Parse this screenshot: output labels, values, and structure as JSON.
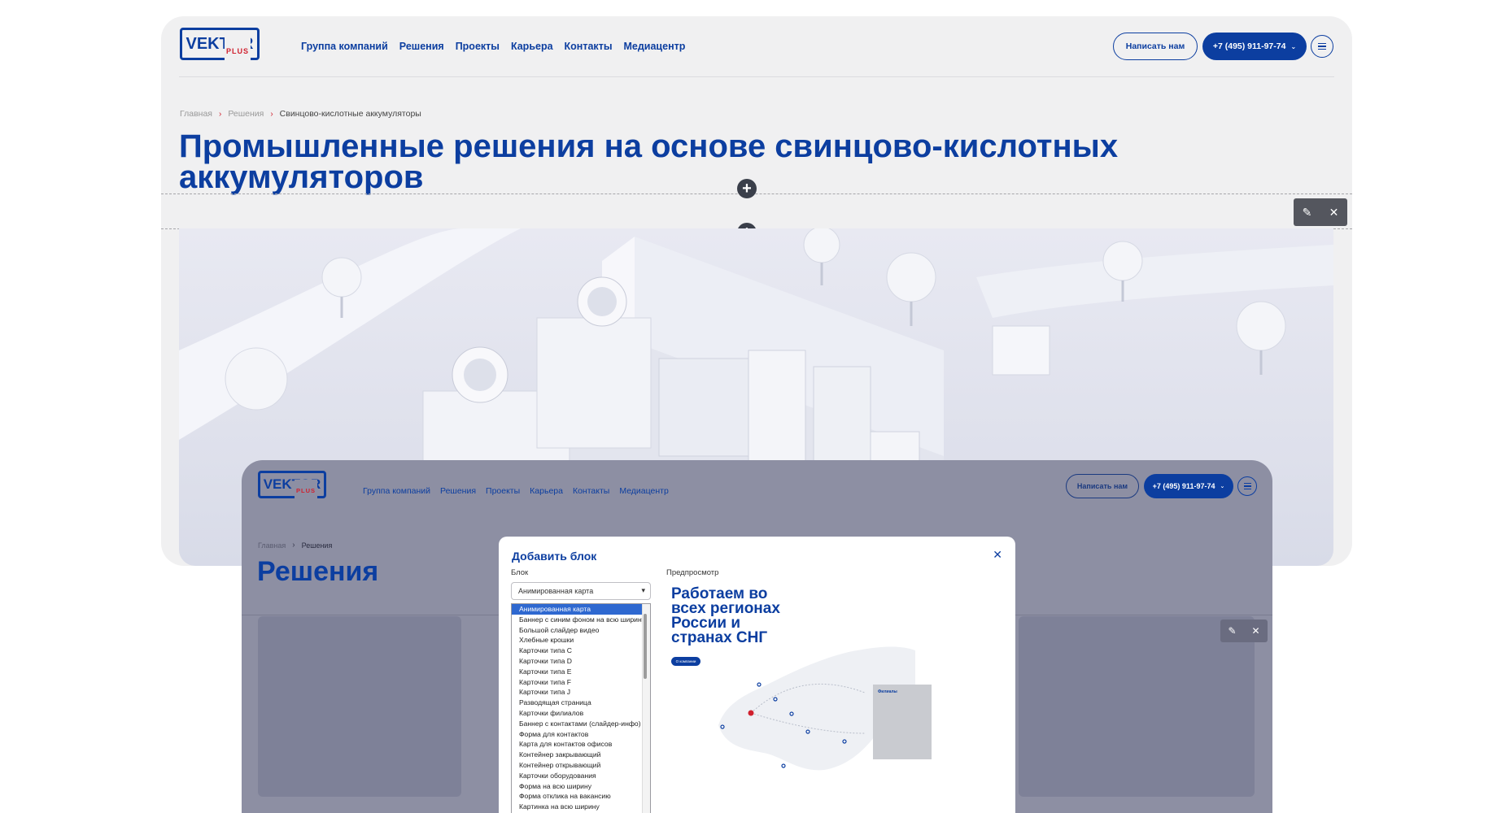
{
  "site": {
    "logo_text": "VEKTOR",
    "logo_sub": "PLUS",
    "nav": [
      "Группа компаний",
      "Решения",
      "Проекты",
      "Карьера",
      "Контакты",
      "Медиацентр"
    ],
    "write_button": "Написать нам",
    "phone_button": "+7 (495) 911-97-74"
  },
  "back_page": {
    "breadcrumbs": [
      "Главная",
      "Решения",
      "Свинцово-кислотные аккумуляторы"
    ],
    "title_line1": "Промышленные решения на основе свинцово-кислотных",
    "title_line2": "аккумуляторов"
  },
  "front_page": {
    "breadcrumbs": [
      "Главная",
      "Решения"
    ],
    "title": "Решения"
  },
  "modal": {
    "title": "Добавить блок",
    "block_label": "Блок",
    "preview_label": "Предпросмотр",
    "selected": "Анимированная карта",
    "options": [
      "Анимированная карта",
      "Баннер с синим фоном на всю ширину",
      "Большой слайдер видео",
      "Хлебные крошки",
      "Карточки типа C",
      "Карточки типа D",
      "Карточки типа E",
      "Карточки типа F",
      "Карточки типа J",
      "Разводящая страница",
      "Карточки филиалов",
      "Баннер с контактами (слайдер-инфо)",
      "Форма для контактов",
      "Карта для контактов офисов",
      "Контейнер закрывающий",
      "Контейнер открывающий",
      "Карточки оборудования",
      "Форма на всю ширину",
      "Форма отклика на вакансию",
      "Картинка на всю ширину"
    ],
    "preview": {
      "title_lines": [
        "Работаем во",
        "всех регионах",
        "России и",
        "странах СНГ"
      ],
      "button": "О компании",
      "panel_title": "Филиалы"
    }
  }
}
